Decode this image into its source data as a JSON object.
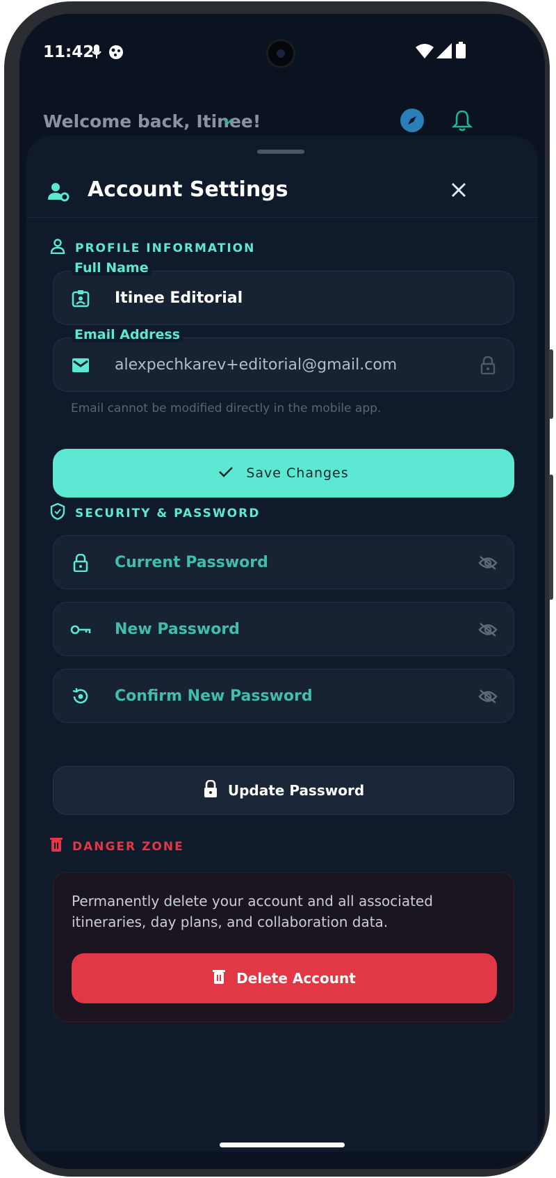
{
  "status_bar": {
    "time": "11:42"
  },
  "header": {
    "welcome": "Welcome back, Itinee!"
  },
  "sheet": {
    "title": "Account Settings"
  },
  "profile": {
    "section_label": "PROFILE INFORMATION",
    "full_name_label": "Full Name",
    "full_name_value": "Itinee Editorial",
    "email_label": "Email Address",
    "email_value": "alexpechkarev+editorial@gmail.com",
    "email_helper": "Email cannot be modified directly in the mobile app.",
    "save_label": "Save Changes"
  },
  "security": {
    "section_label": "SECURITY & PASSWORD",
    "current_placeholder": "Current Password",
    "new_placeholder": "New Password",
    "confirm_placeholder": "Confirm New Password",
    "update_label": "Update Password"
  },
  "danger": {
    "section_label": "DANGER ZONE",
    "description": "Permanently delete your account and all associated itineraries, day plans, and collaboration data.",
    "delete_label": "Delete Account"
  },
  "colors": {
    "accent": "#5ce8d3",
    "danger": "#e23745",
    "background": "#0b1320",
    "surface": "#172233"
  }
}
